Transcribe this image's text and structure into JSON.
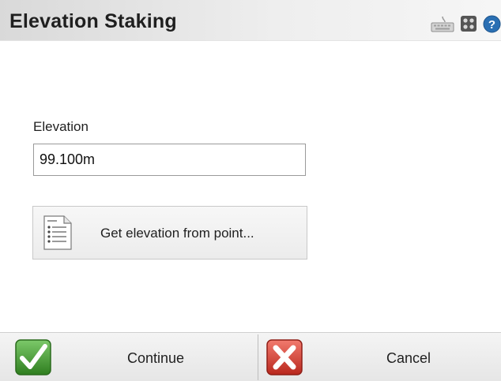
{
  "header": {
    "title": "Elevation Staking",
    "icons": [
      "keyboard-icon",
      "apps-icon",
      "help-icon"
    ],
    "help_glyph": "?"
  },
  "form": {
    "elevation_label": "Elevation",
    "elevation_value": "99.100m"
  },
  "pick_button": {
    "label": "Get elevation from point...",
    "icon": "point-list-icon"
  },
  "footer": {
    "continue_label": "Continue",
    "cancel_label": "Cancel",
    "continue_icon": "checkmark-icon",
    "cancel_icon": "cross-icon"
  },
  "colors": {
    "continue_green": "#3f9a2c",
    "cancel_red": "#d23a2e",
    "help_blue": "#2a6fb3"
  }
}
